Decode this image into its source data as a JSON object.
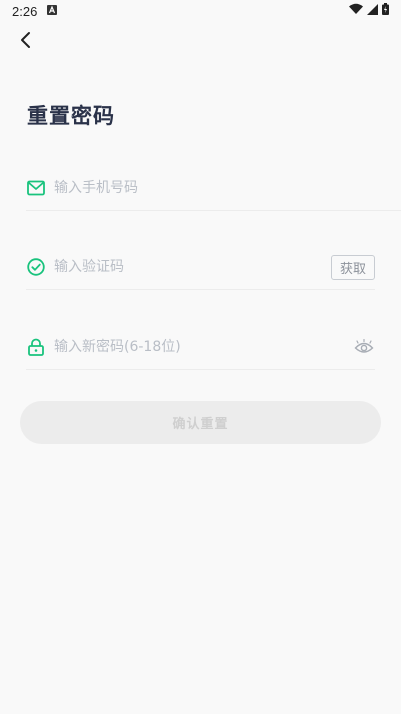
{
  "status_bar": {
    "time": "2:26",
    "left_icons": [
      "a-icon"
    ],
    "right_icons": [
      "wifi-icon",
      "signal-icon",
      "battery-icon"
    ]
  },
  "header": {
    "back_icon": "chevron-left-icon"
  },
  "page": {
    "title": "重置密码"
  },
  "form": {
    "phone": {
      "placeholder": "输入手机号码",
      "value": "",
      "icon": "mail-icon"
    },
    "code": {
      "placeholder": "输入验证码",
      "value": "",
      "icon": "check-circle-icon",
      "get_code_label": "获取"
    },
    "password": {
      "placeholder": "输入新密码(6-18位)",
      "value": "",
      "icon": "lock-icon",
      "toggle_icon": "eye-icon"
    },
    "submit_label": "确认重置"
  },
  "colors": {
    "accent": "#19c37d",
    "title": "#2a3249",
    "placeholder": "#b9bec6",
    "button_disabled_bg": "#ececec",
    "button_disabled_text": "#cfcfcf"
  }
}
